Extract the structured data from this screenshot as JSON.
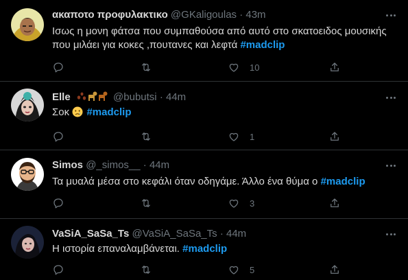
{
  "tweets": [
    {
      "display_name": "ακαποτο προφυλακτικο",
      "handle": "@GKaligoulas",
      "separator": "·",
      "time": "43m",
      "text_line1": "Ισως η μονη φάτσα που συμπαθούσα από αυτό στο σκατοειδος μουσικής",
      "text_line2": "που μιλάει για κοκες ,πουτανες και λεφτά",
      "hashtag": "#madclip",
      "likes": "10"
    },
    {
      "display_name": "Elle",
      "name_emojis": [
        "paw-prints",
        "dog",
        "dog"
      ],
      "handle": "@bubutsi",
      "separator": "·",
      "time": "44m",
      "text": "Σοκ",
      "text_emoji": "crying-face",
      "hashtag": "#madclip",
      "likes": "1"
    },
    {
      "display_name": "Simos",
      "handle": "@_simos__",
      "separator": "·",
      "time": "44m",
      "text": "Τα μυαλά μέσα στο κεφάλι όταν οδηγάμε. Άλλο ένα θύμα ο",
      "hashtag": "#madclip",
      "likes": "3"
    },
    {
      "display_name": "VaSiA_SaSa_Ts",
      "handle": "@VaSiA_SaSa_Ts",
      "separator": "·",
      "time": "44m",
      "text": "Η ιστορία επαναλαμβάνεται.",
      "hashtag": "#madclip",
      "likes": "5"
    }
  ],
  "colors": {
    "background": "#000000",
    "text": "#d9d9d9",
    "muted": "#6e767d",
    "accent": "#1d9bf0",
    "divider": "#2f3336"
  },
  "icons": [
    "reply-icon",
    "retweet-icon",
    "like-icon",
    "share-icon",
    "more-icon"
  ]
}
